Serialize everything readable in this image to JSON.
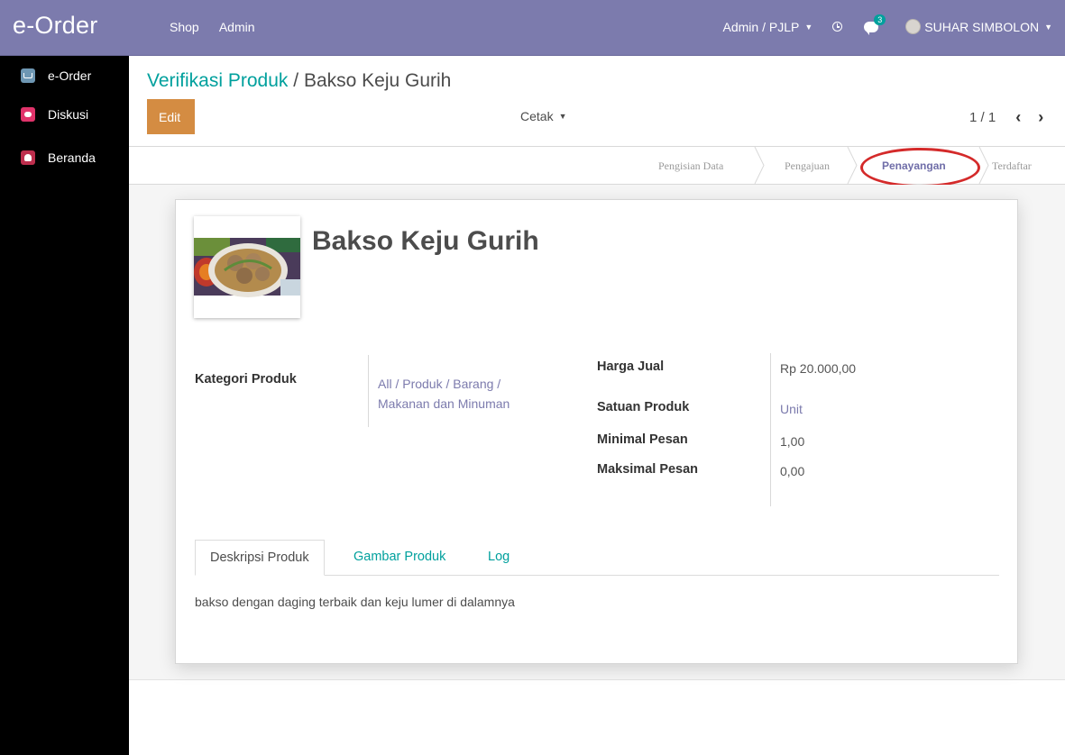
{
  "navbar": {
    "brand": "e-Order",
    "menu": [
      "Shop",
      "Admin"
    ],
    "company": "Admin / PJLP",
    "chat_badge": "3",
    "user_name": "SUHAR SIMBOLON",
    "colors": {
      "bar": "#7c7bad",
      "badge": "#00a09d"
    }
  },
  "sidebar": {
    "items": [
      {
        "label": "e-Order",
        "icon": "cart-icon"
      },
      {
        "label": "Diskusi",
        "icon": "chat-icon"
      },
      {
        "label": "Beranda",
        "icon": "home-icon"
      }
    ]
  },
  "control_panel": {
    "breadcrumb_parent": "Verifikasi Produk",
    "breadcrumb_sep": "/",
    "breadcrumb_current": "Bakso Keju Gurih",
    "edit_label": "Edit",
    "print_label": "Cetak",
    "pager_value": "1 / 1"
  },
  "statusbar": {
    "stages": [
      "Pengisian Data",
      "Pengajuan",
      "Penayangan",
      "Terdaftar"
    ],
    "active_stage": "Penayangan",
    "highlight_color": "#d42a2a"
  },
  "form": {
    "product_name": "Bakso Keju Gurih",
    "category_label": "Kategori Produk",
    "category_value_line1": "All / Produk / Barang /",
    "category_value_line2": "Makanan dan Minuman",
    "price_label": "Harga Jual",
    "price_value": "Rp 20.000,00",
    "unit_label": "Satuan Produk",
    "unit_value": "Unit",
    "min_order_label": "Minimal Pesan",
    "min_order_value": "1,00",
    "max_order_label": "Maksimal Pesan",
    "max_order_value": "0,00"
  },
  "notebook": {
    "tabs": [
      "Deskripsi Produk",
      "Gambar Produk",
      "Log"
    ],
    "active_tab": "Deskripsi Produk",
    "description": "bakso dengan daging terbaik dan keju lumer di dalamnya"
  }
}
